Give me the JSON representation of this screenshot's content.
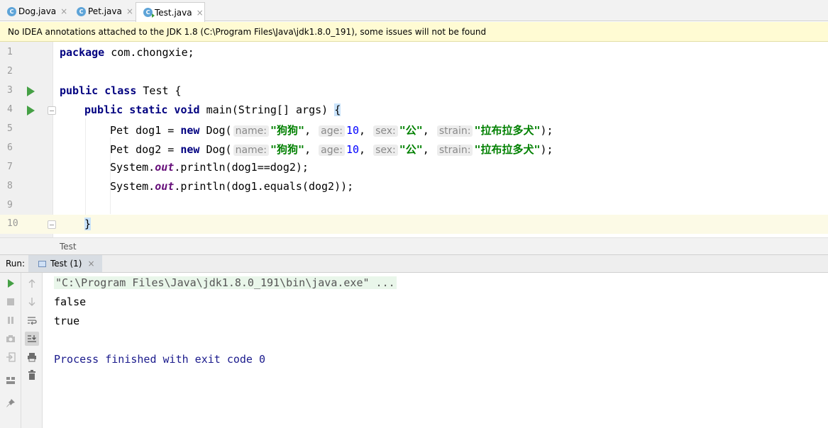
{
  "tabs": [
    {
      "icon": "class-icon",
      "label": "Dog.java",
      "active": false
    },
    {
      "icon": "class-icon",
      "label": "Pet.java",
      "active": false
    },
    {
      "icon": "class-run-icon",
      "label": "Test.java",
      "active": true
    }
  ],
  "close_glyph": "×",
  "notice": "No IDEA annotations attached to the JDK 1.8 (C:\\Program Files\\Java\\jdk1.8.0_191), some issues will not be found",
  "editor": {
    "line_numbers": [
      "1",
      "2",
      "3",
      "4",
      "5",
      "6",
      "7",
      "8",
      "9",
      "10"
    ],
    "lines": {
      "l1": {
        "kw": "package",
        "rest": " com.chongxie;"
      },
      "l3": {
        "kw": "public class",
        "rest": " Test {"
      },
      "l4": {
        "kw": "public static void",
        "rest": " main(String[] args) ",
        "brace": "{"
      },
      "l5": {
        "pre": "Pet dog1 = ",
        "kw": "new",
        "call": " Dog(",
        "h1": "name:",
        "s1": "\"狗狗\"",
        "h2": "age:",
        "n1": "10",
        "h3": "sex:",
        "s2": "\"公\"",
        "h4": "strain:",
        "s3": "\"拉布拉多犬\"",
        "end": ");"
      },
      "l6": {
        "pre": "Pet dog2 = ",
        "kw": "new",
        "call": " Dog(",
        "h1": "name:",
        "s1": "\"狗狗\"",
        "h2": "age:",
        "n1": "10",
        "h3": "sex:",
        "s2": "\"公\"",
        "h4": "strain:",
        "s3": "\"拉布拉多犬\"",
        "end": ");"
      },
      "l7": {
        "pre": "System.",
        "fld": "out",
        "rest": ".println(dog1==dog2);"
      },
      "l8": {
        "pre": "System.",
        "fld": "out",
        "rest": ".println(dog1.equals(dog2));"
      },
      "l10": {
        "brace": "}"
      }
    },
    "comma": ", "
  },
  "breadcrumb": "Test",
  "run_panel": {
    "label": "Run:",
    "tab_label": "Test (1)",
    "console": [
      {
        "type": "cmd",
        "text": "\"C:\\Program Files\\Java\\jdk1.8.0_191\\bin\\java.exe\" ..."
      },
      {
        "type": "out",
        "text": "false"
      },
      {
        "type": "out",
        "text": "true"
      },
      {
        "type": "blank",
        "text": ""
      },
      {
        "type": "exit",
        "text": "Process finished with exit code 0"
      }
    ]
  },
  "colors": {
    "keyword": "#000080",
    "string": "#008000",
    "number": "#0000ff",
    "static_field": "#660e7a",
    "run_green": "#45a045",
    "notice_bg": "#fffbd3"
  }
}
